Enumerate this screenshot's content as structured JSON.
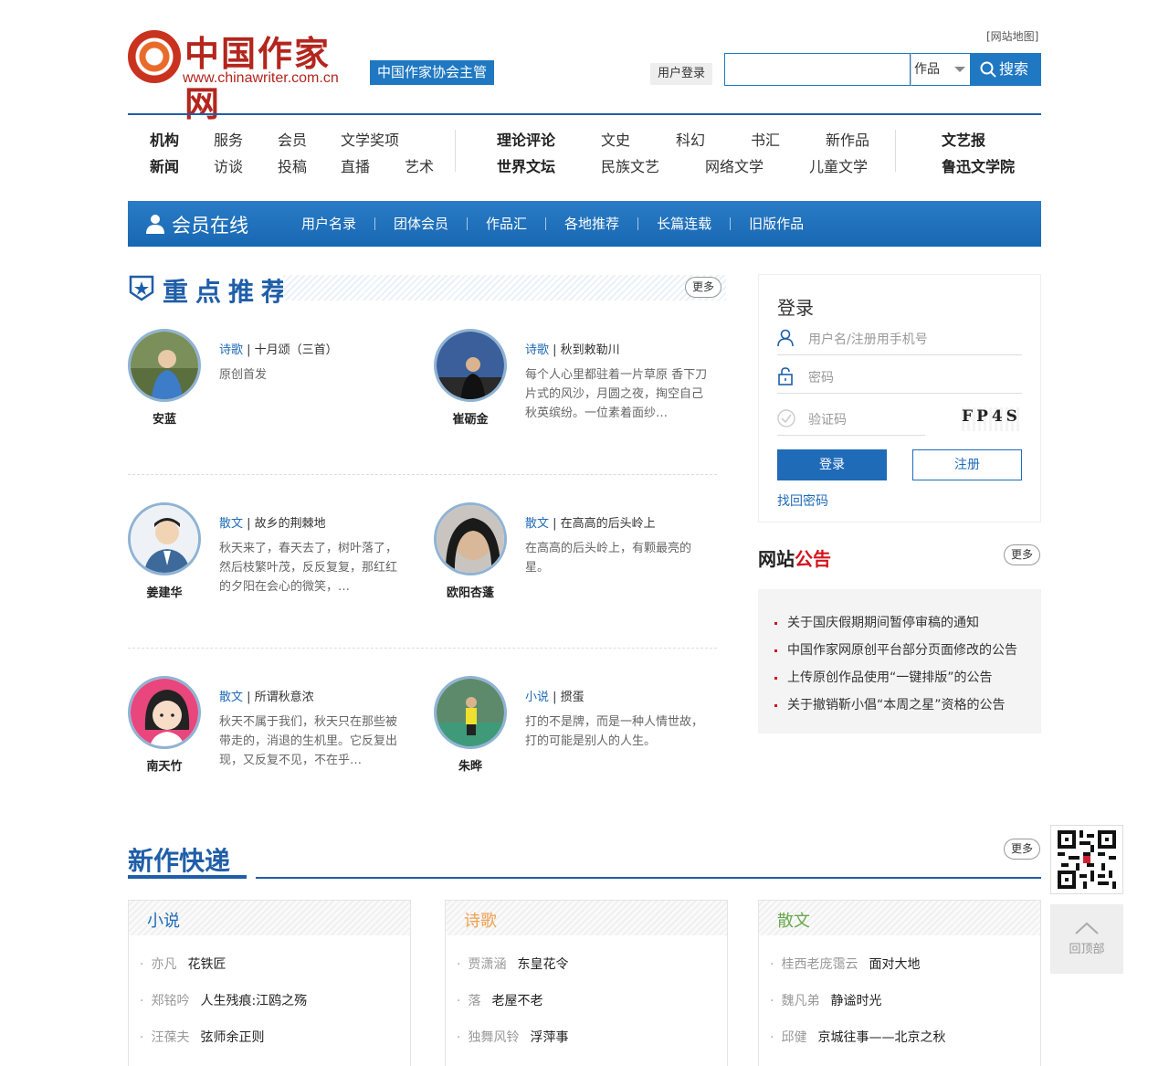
{
  "header": {
    "logo_cn": "中国作家网",
    "logo_url": "www.chinawriter.com.cn",
    "badge": "中国作家协会主管",
    "sitemap": "[网站地图]",
    "user_login": "用户登录",
    "search": {
      "placeholder": "",
      "select": "作品",
      "button": "搜索"
    }
  },
  "nav": {
    "group1_row1": [
      "机构",
      "服务",
      "会员",
      "文学奖项"
    ],
    "group1_row2": [
      "新闻",
      "访谈",
      "投稿",
      "直播",
      "艺术"
    ],
    "group2_row1": [
      "理论评论",
      "文史",
      "科幻",
      "书汇",
      "新作品"
    ],
    "group2_row2": [
      "世界文坛",
      "民族文艺",
      "网络文学",
      "儿童文学"
    ],
    "group3": [
      "文艺报",
      "鲁迅文学院"
    ]
  },
  "member_bar": {
    "title": "会员在线",
    "items": [
      "用户名录",
      "团体会员",
      "作品汇",
      "各地推荐",
      "长篇连载",
      "旧版作品"
    ]
  },
  "featured": {
    "title": "重点推荐",
    "more": "更多",
    "items": [
      {
        "name": "安蓝",
        "cat": "诗歌",
        "title": "十月颂（三首）",
        "desc": "原创首发"
      },
      {
        "name": "崔砺金",
        "cat": "诗歌",
        "title": "秋到敕勒川",
        "desc": "每个人心里都驻着一片草原 香下刀片式的风沙，月圆之夜，掏空自己 秋英缤纷。一位素着面纱…"
      },
      {
        "name": "姜建华",
        "cat": "散文",
        "title": "故乡的荆棘地",
        "desc": "秋天来了，春天去了，树叶落了，然后枝繁叶茂，反反复复，那红红的夕阳在会心的微笑，…"
      },
      {
        "name": "欧阳杏蓬",
        "cat": "散文",
        "title": "在高高的后头岭上",
        "desc": "在高高的后头岭上，有颗最亮的星。"
      },
      {
        "name": "南天竹",
        "cat": "散文",
        "title": "所谓秋意浓",
        "desc": "秋天不属于我们，秋天只在那些被带走的，消退的生机里。它反复出现，又反复不见，不在乎…"
      },
      {
        "name": "朱晔",
        "cat": "小说",
        "title": "掼蛋",
        "desc": "打的不是牌，而是一种人情世故，打的可能是别人的人生。"
      }
    ]
  },
  "login": {
    "title": "登录",
    "username_ph": "用户名/注册用手机号",
    "password_ph": "密码",
    "captcha_ph": "验证码",
    "captcha": "FP4S",
    "login_btn": "登录",
    "register_btn": "注册",
    "forgot": "找回密码"
  },
  "notice": {
    "title_a": "网站",
    "title_b": "公告",
    "more": "更多",
    "items": [
      "关于国庆假期期间暂停审稿的通知",
      "中国作家网原创平台部分页面修改的公告",
      "上传原创作品使用“一键排版”的公告",
      "关于撤销靳小倡“本周之星”资格的公告"
    ]
  },
  "new_works": {
    "title": "新作快递",
    "more": "更多",
    "columns": [
      {
        "name": "小说",
        "color": "#1f6bb8",
        "items": [
          {
            "author": "亦凡",
            "title": "花铁匠"
          },
          {
            "author": "郑铭吟",
            "title": "人生残痕:江鸥之殇"
          },
          {
            "author": "汪葆夫",
            "title": "弦师余正则"
          }
        ]
      },
      {
        "name": "诗歌",
        "color": "#f0a050",
        "items": [
          {
            "author": "贾潇涵",
            "title": "东皇花令"
          },
          {
            "author": "落",
            "title": "老屋不老"
          },
          {
            "author": "独舞风铃",
            "title": "浮萍事"
          }
        ]
      },
      {
        "name": "散文",
        "color": "#6aa84f",
        "items": [
          {
            "author": "桂西老庞霭云",
            "title": "面对大地"
          },
          {
            "author": "魏凡弟",
            "title": "静谧时光"
          },
          {
            "author": "邱健",
            "title": "京城往事——北京之秋"
          }
        ]
      }
    ]
  },
  "float": {
    "totop": "回顶部"
  }
}
